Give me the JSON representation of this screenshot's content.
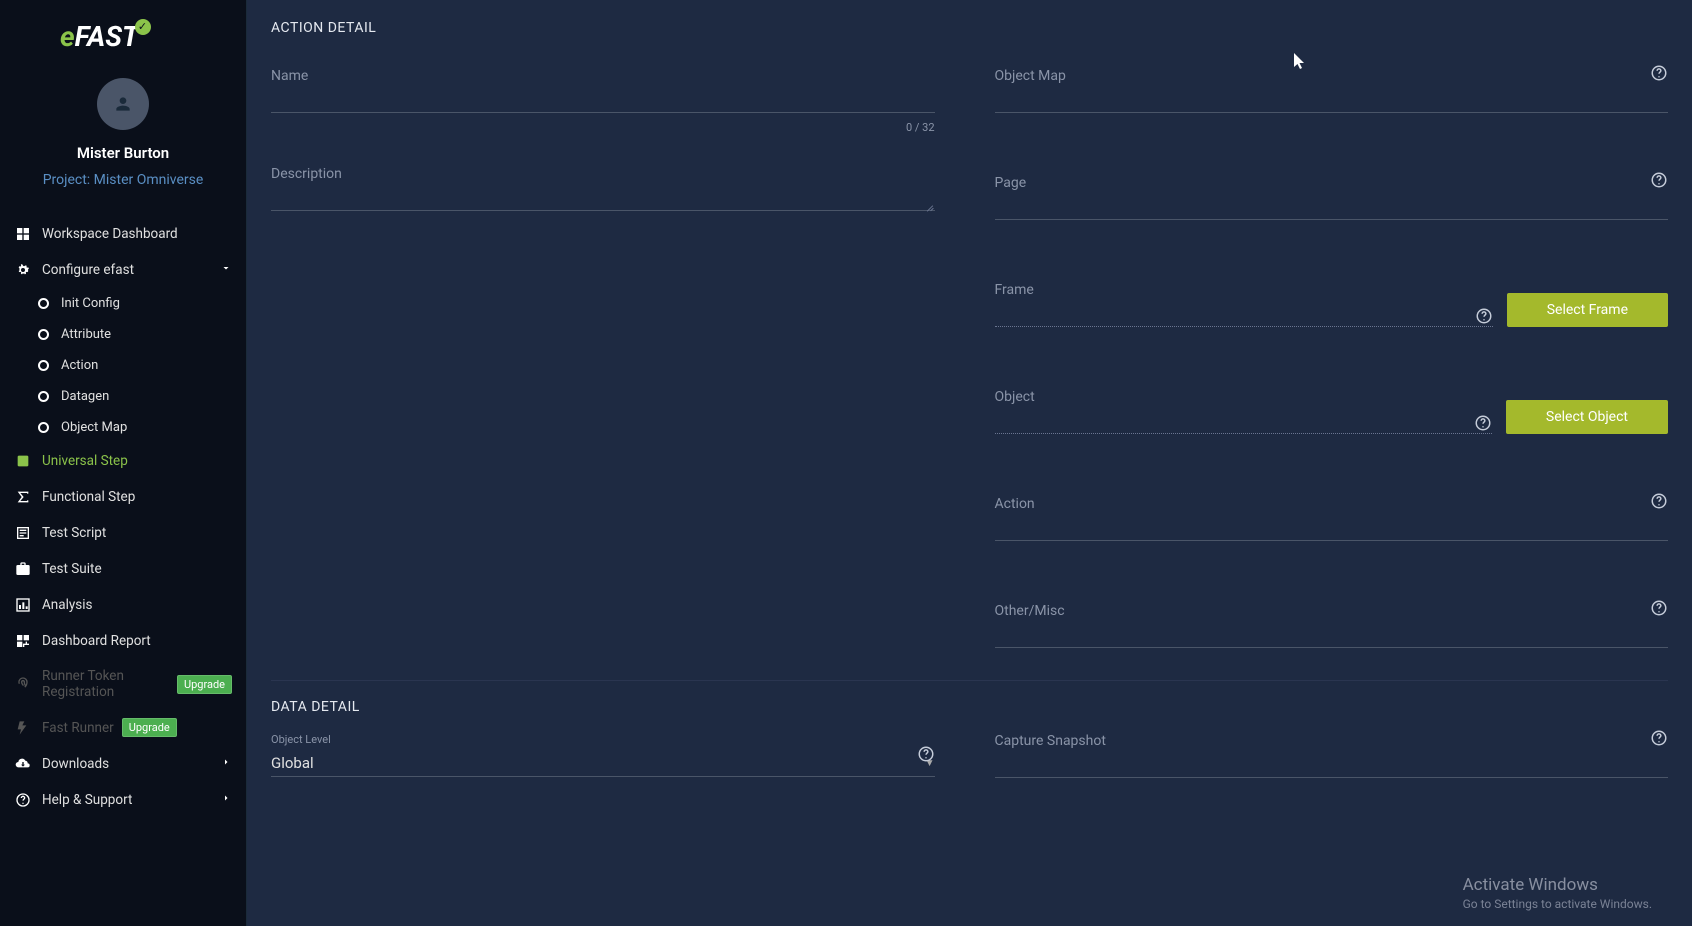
{
  "logo": {
    "text_e": "e",
    "text_rest": "FAST"
  },
  "profile": {
    "username": "Mister Burton",
    "project": "Project: Mister Omniverse"
  },
  "nav": {
    "workspace": "Workspace Dashboard",
    "configure": "Configure efast",
    "sub": {
      "init": "Init Config",
      "attribute": "Attribute",
      "action": "Action",
      "datagen": "Datagen",
      "objectmap": "Object Map"
    },
    "universal": "Universal Step",
    "functional": "Functional Step",
    "testscript": "Test Script",
    "testsuite": "Test Suite",
    "analysis": "Analysis",
    "dashboardreport": "Dashboard Report",
    "runnertoken": "Runner Token Registration",
    "fastrunner": "Fast Runner",
    "upgrade": "Upgrade",
    "downloads": "Downloads",
    "help": "Help & Support"
  },
  "form": {
    "section1_title": "ACTION DETAIL",
    "section2_title": "DATA DETAIL",
    "name_label": "Name",
    "name_counter": "0 / 32",
    "description_label": "Description",
    "objectmap_label": "Object Map",
    "page_label": "Page",
    "frame_label": "Frame",
    "select_frame_btn": "Select Frame",
    "object_label": "Object",
    "select_object_btn": "Select Object",
    "action_label": "Action",
    "other_label": "Other/Misc",
    "object_level_label": "Object Level",
    "object_level_value": "Global",
    "capture_label": "Capture Snapshot"
  },
  "watermark": {
    "title": "Activate Windows",
    "sub": "Go to Settings to activate Windows."
  }
}
